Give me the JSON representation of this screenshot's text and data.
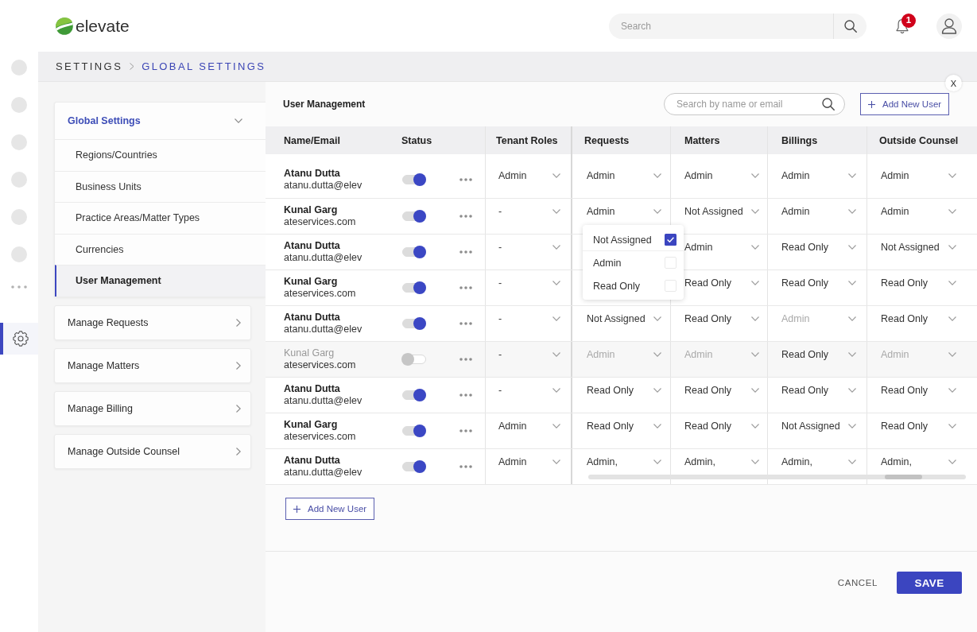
{
  "header": {
    "brand": "elevate",
    "search": {
      "placeholder": "Search"
    },
    "notifications": {
      "count": "1"
    }
  },
  "rail": [
    {
      "kind": "dot",
      "selected": false
    },
    {
      "kind": "dot",
      "selected": false
    },
    {
      "kind": "dot",
      "selected": false
    },
    {
      "kind": "dot",
      "selected": false
    },
    {
      "kind": "dot",
      "selected": false
    },
    {
      "kind": "dot",
      "selected": false
    },
    {
      "kind": "more",
      "selected": false
    },
    {
      "kind": "settings",
      "selected": true
    }
  ],
  "breadcrumb": [
    {
      "label": "SETTINGS",
      "current": false
    },
    {
      "label": "GLOBAL SETTINGS",
      "current": true
    }
  ],
  "sidebar": {
    "groups": [
      {
        "label": "Global Settings",
        "expanded": true,
        "items": [
          {
            "label": "Regions/Countries",
            "selected": false
          },
          {
            "label": "Business Units",
            "selected": false
          },
          {
            "label": "Practice Areas/Matter Types",
            "selected": false
          },
          {
            "label": "Currencies",
            "selected": false
          },
          {
            "label": "User Management",
            "selected": true
          }
        ]
      },
      {
        "label": "Manage Requests",
        "expanded": false
      },
      {
        "label": "Manage Matters",
        "expanded": false
      },
      {
        "label": "Manage Billing",
        "expanded": false
      },
      {
        "label": "Manage Outside Counsel",
        "expanded": false
      }
    ]
  },
  "panel": {
    "close": "X",
    "title": "User Management",
    "search": {
      "placeholder": "Search by name or email"
    },
    "add_button": "Add New User",
    "table": {
      "columns": [
        "Name/Email",
        "Status",
        "Tenant Roles",
        "Requests",
        "Matters",
        "Billings",
        "Outside Counsel"
      ],
      "rows": [
        {
          "cells": [
            {
              "kind": "user",
              "name": "Atanu Dutta",
              "email": "atanu.dutta@elev"
            },
            {
              "kind": "status",
              "active": true
            },
            {
              "kind": "select",
              "value": "Admin",
              "disabled": false
            },
            {
              "kind": "select",
              "value": "Admin",
              "disabled": false
            },
            {
              "kind": "select",
              "value": "Admin",
              "disabled": false
            },
            {
              "kind": "select",
              "value": "Admin",
              "disabled": false
            },
            {
              "kind": "select",
              "value": "Admin",
              "disabled": false
            }
          ]
        },
        {
          "cells": [
            {
              "kind": "user",
              "name": "Kunal Garg",
              "email": "ateservices.com"
            },
            {
              "kind": "status",
              "active": true
            },
            {
              "kind": "select",
              "value": "-",
              "disabled": false
            },
            {
              "kind": "select",
              "value": "Admin",
              "disabled": false
            },
            {
              "kind": "select",
              "value": "Not Assigned",
              "disabled": false
            },
            {
              "kind": "select",
              "value": "Admin",
              "disabled": false
            },
            {
              "kind": "select",
              "value": "Admin",
              "disabled": false
            }
          ]
        },
        {
          "cells": [
            {
              "kind": "user",
              "name": "Atanu Dutta",
              "email": "atanu.dutta@elev"
            },
            {
              "kind": "status",
              "active": true
            },
            {
              "kind": "select",
              "value": "-",
              "disabled": false
            },
            {
              "kind": "menu",
              "options": [
                {
                  "label": "Not Assigned",
                  "checked": true
                },
                {
                  "label": "Admin",
                  "checked": false
                },
                {
                  "label": "Read Only",
                  "checked": false
                }
              ]
            },
            {
              "kind": "select",
              "value": "Admin",
              "disabled": false
            },
            {
              "kind": "select",
              "value": "Read Only",
              "disabled": false
            },
            {
              "kind": "select",
              "value": "Not Assigned",
              "disabled": false
            }
          ]
        },
        {
          "cells": [
            {
              "kind": "user",
              "name": "Kunal Garg",
              "email": "ateservices.com"
            },
            {
              "kind": "status",
              "active": true
            },
            {
              "kind": "select",
              "value": "-",
              "disabled": false
            },
            {
              "kind": "covered"
            },
            {
              "kind": "select",
              "value": "Read Only",
              "disabled": false
            },
            {
              "kind": "select",
              "value": "Read Only",
              "disabled": false
            },
            {
              "kind": "select",
              "value": "Read Only",
              "disabled": false
            }
          ]
        },
        {
          "cells": [
            {
              "kind": "user",
              "name": "Atanu Dutta",
              "email": "atanu.dutta@elev"
            },
            {
              "kind": "status",
              "active": true
            },
            {
              "kind": "select",
              "value": "-",
              "disabled": false
            },
            {
              "kind": "select",
              "value": "Not Assigned",
              "disabled": false
            },
            {
              "kind": "select",
              "value": "Read Only",
              "disabled": false
            },
            {
              "kind": "select",
              "value": "Admin",
              "disabled": true
            },
            {
              "kind": "select",
              "value": "Read Only",
              "disabled": false
            }
          ]
        },
        {
          "cells": [
            {
              "kind": "user",
              "name": "Kunal Garg",
              "email": "ateservices.com"
            },
            {
              "kind": "status",
              "active": false
            },
            {
              "kind": "select",
              "value": "-",
              "disabled": false
            },
            {
              "kind": "select",
              "value": "Admin",
              "disabled": true
            },
            {
              "kind": "select",
              "value": "Admin",
              "disabled": true
            },
            {
              "kind": "select",
              "value": "Read Only",
              "disabled": false
            },
            {
              "kind": "select",
              "value": "Admin",
              "disabled": true
            }
          ]
        },
        {
          "cells": [
            {
              "kind": "user",
              "name": "Atanu Dutta",
              "email": "atanu.dutta@elev"
            },
            {
              "kind": "status",
              "active": true
            },
            {
              "kind": "select",
              "value": "-",
              "disabled": false
            },
            {
              "kind": "select",
              "value": "Read Only",
              "disabled": false
            },
            {
              "kind": "select",
              "value": "Read Only",
              "disabled": false
            },
            {
              "kind": "select",
              "value": "Read Only",
              "disabled": false
            },
            {
              "kind": "select",
              "value": "Read Only",
              "disabled": false
            }
          ]
        },
        {
          "cells": [
            {
              "kind": "user",
              "name": "Kunal Garg",
              "email": "ateservices.com"
            },
            {
              "kind": "status",
              "active": true
            },
            {
              "kind": "select",
              "value": "Admin",
              "disabled": false
            },
            {
              "kind": "select",
              "value": "Read Only",
              "disabled": false
            },
            {
              "kind": "select",
              "value": "Read Only",
              "disabled": false
            },
            {
              "kind": "select",
              "value": "Not Assigned",
              "disabled": false
            },
            {
              "kind": "select",
              "value": "Read Only",
              "disabled": false
            }
          ]
        },
        {
          "cells": [
            {
              "kind": "user",
              "name": "Atanu Dutta",
              "email": "atanu.dutta@elev"
            },
            {
              "kind": "status",
              "active": true
            },
            {
              "kind": "select",
              "value": "Admin",
              "disabled": false
            },
            {
              "kind": "select",
              "value": "Admin,",
              "disabled": false
            },
            {
              "kind": "select",
              "value": "Admin,",
              "disabled": false
            },
            {
              "kind": "select",
              "value": "Admin,",
              "disabled": false
            },
            {
              "kind": "select",
              "value": "Admin,",
              "disabled": false
            }
          ]
        }
      ]
    },
    "add_button_bottom": "Add New User",
    "cancel": "CANCEL",
    "save": "SAVE"
  }
}
